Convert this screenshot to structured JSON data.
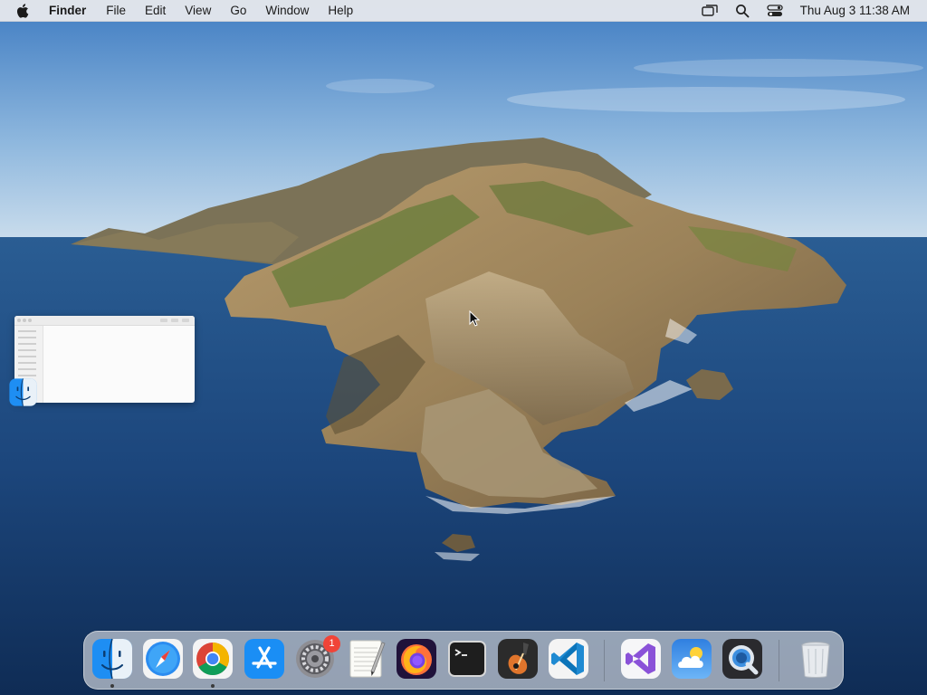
{
  "menubar": {
    "app_name": "Finder",
    "menus": [
      "File",
      "Edit",
      "View",
      "Go",
      "Window",
      "Help"
    ],
    "clock": "Thu Aug 3  11:38 AM",
    "status_icons": [
      "screen-mirroring-icon",
      "spotlight-search-icon",
      "control-center-icon"
    ]
  },
  "desktop": {
    "wallpaper": "macOS Catalina island"
  },
  "dock": {
    "apps": [
      {
        "name": "Finder",
        "icon": "finder-icon",
        "running": true
      },
      {
        "name": "Safari",
        "icon": "safari-icon",
        "running": false
      },
      {
        "name": "Google Chrome",
        "icon": "chrome-icon",
        "running": true
      },
      {
        "name": "App Store",
        "icon": "app-store-icon",
        "running": false
      },
      {
        "name": "System Preferences",
        "icon": "system-preferences-icon",
        "running": false,
        "badge": "1"
      },
      {
        "name": "TextEdit",
        "icon": "textedit-icon",
        "running": false
      },
      {
        "name": "Firefox",
        "icon": "firefox-icon",
        "running": false
      },
      {
        "name": "Terminal",
        "icon": "terminal-icon",
        "running": false
      },
      {
        "name": "GarageBand",
        "icon": "garageband-icon",
        "running": false
      },
      {
        "name": "Visual Studio Code",
        "icon": "vscode-icon",
        "running": false
      },
      {
        "name": "Visual Studio",
        "icon": "visual-studio-icon",
        "running": false
      },
      {
        "name": "Weather",
        "icon": "weather-icon",
        "running": false
      },
      {
        "name": "QuickTime Player",
        "icon": "quicktime-icon",
        "running": false
      },
      {
        "name": "Trash",
        "icon": "trash-icon",
        "running": false
      }
    ]
  },
  "colors": {
    "sky_top": "#4a86c8",
    "sea": "#1d4475",
    "badge": "#f04438"
  }
}
